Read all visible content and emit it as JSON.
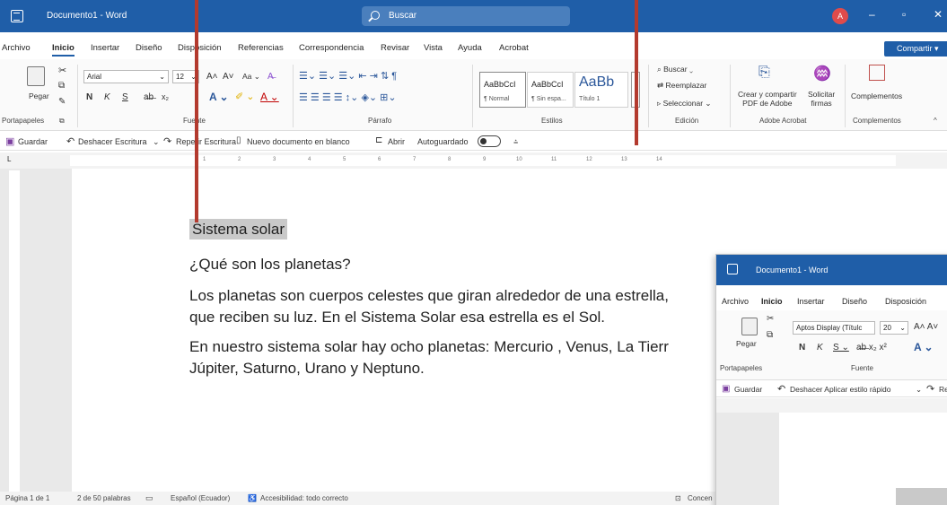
{
  "window": {
    "title": "Documento1 - Word",
    "search_placeholder": "Buscar",
    "user_initial": "A",
    "share_label": "Compartir"
  },
  "menu_tabs": [
    "Archivo",
    "Inicio",
    "Insertar",
    "Diseño",
    "Disposición",
    "Referencias",
    "Correspondencia",
    "Revisar",
    "Vista",
    "Ayuda",
    "Acrobat"
  ],
  "ribbon": {
    "clipboard": {
      "paste_label": "Pegar",
      "group_label": "Portapapeles"
    },
    "font": {
      "font_name": "Arial",
      "font_size": "12",
      "group_label": "Fuente",
      "bold": "N",
      "italic": "K",
      "underline": "S"
    },
    "paragraph": {
      "group_label": "Párrafo"
    },
    "styles": {
      "group_label": "Estilos",
      "items": [
        {
          "sample": "AaBbCcI",
          "name": "¶ Normal"
        },
        {
          "sample": "AaBbCcI",
          "name": "¶ Sin espa..."
        },
        {
          "sample": "AaBb",
          "name": "Título 1"
        }
      ]
    },
    "editing": {
      "group_label": "Edición",
      "find": "Buscar",
      "replace": "Reemplazar",
      "select": "Seleccionar"
    },
    "acrobat": {
      "group_label": "Adobe Acrobat",
      "create_pdf": "Crear y compartir\nPDF de Adobe",
      "request_signatures": "Solicitar\nfirmas"
    },
    "addins": {
      "group_label": "Complementos",
      "label": "Complementos"
    }
  },
  "quick_access": {
    "save": "Guardar",
    "undo": "Deshacer Escritura",
    "redo": "Repetir Escritura",
    "new_blank": "Nuevo documento en blanco",
    "open": "Abrir",
    "autosave": "Autoguardado"
  },
  "ruler_numbers": [
    "1",
    "2",
    "3",
    "4",
    "5",
    "6",
    "7",
    "8",
    "9",
    "10",
    "11",
    "12",
    "13",
    "14"
  ],
  "document": {
    "title_selected": "Sistema solar",
    "question": "¿Qué son los planetas?",
    "para1_line1": "Los planetas son cuerpos celestes que giran alrededor de una estrella,",
    "para1_line2": "que reciben su luz. En el Sistema Solar esa estrella es el Sol.",
    "para2_line1": "En nuestro sistema solar hay ocho planetas: Mercurio , Venus, La Tierr",
    "para2_line2": "Júpiter, Saturno, Urano y Neptuno."
  },
  "status": {
    "page": "Página 1 de 1",
    "words": "2 de 50 palabras",
    "language": "Español (Ecuador)",
    "accessibility": "Accesibilidad: todo correcto",
    "focus": "Concen"
  },
  "second_window": {
    "title": "Documento1 - Word",
    "tabs": [
      "Archivo",
      "Inicio",
      "Insertar",
      "Diseño",
      "Disposición"
    ],
    "font_name": "Aptos Display (Títulc",
    "font_size": "20",
    "paste_label": "Pegar",
    "clipboard_label": "Portapapeles",
    "font_group_label": "Fuente",
    "save": "Guardar",
    "undo": "Deshacer Aplicar estilo rápido",
    "redo_partial": "Re"
  },
  "colors": {
    "title_bar": "#1f5ea8",
    "callout": "#b33a2e",
    "selection": "#c9c9c9"
  }
}
